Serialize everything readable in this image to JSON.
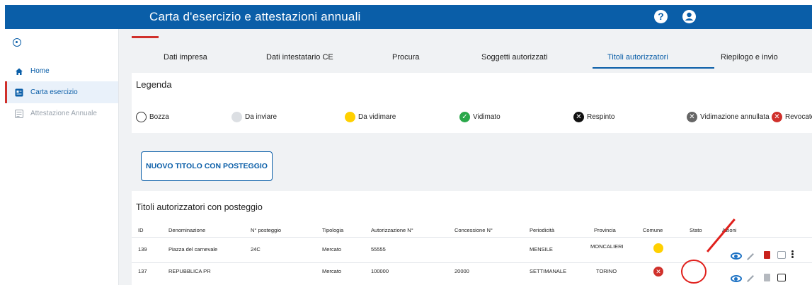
{
  "header": {
    "title": "Carta d'esercizio e attestazioni annuali",
    "help_label": "?",
    "user_label": ""
  },
  "sidebar": {
    "items": [
      {
        "label": "Home"
      },
      {
        "label": "Carta esercizio"
      },
      {
        "label": "Attestazione Annuale"
      }
    ]
  },
  "tabs": [
    {
      "label": "Dati impresa"
    },
    {
      "label": "Dati intestatario CE"
    },
    {
      "label": "Procura"
    },
    {
      "label": "Soggetti autorizzati"
    },
    {
      "label": "Titoli autorizzatori"
    },
    {
      "label": "Riepilogo e invio"
    }
  ],
  "legend": {
    "title": "Legenda",
    "items": [
      {
        "label": "Bozza"
      },
      {
        "label": "Da inviare"
      },
      {
        "label": "Da vidimare"
      },
      {
        "label": "Vidimato"
      },
      {
        "label": "Respinto"
      },
      {
        "label": "Vidimazione annullata"
      },
      {
        "label": "Revocato"
      }
    ]
  },
  "actions": {
    "new_title_button": "NUOVO TITOLO CON POSTEGGIO"
  },
  "table": {
    "title": "Titoli autorizzatori con posteggio",
    "columns": [
      "ID",
      "Denominazione",
      "N° posteggio",
      "Tipologia",
      "Autorizzazione N°",
      "Concessione N°",
      "Periodicità",
      "Provincia",
      "Comune",
      "Stato",
      "Azioni"
    ],
    "rows": [
      {
        "id": "139",
        "denominazione": "Piazza del carnevale",
        "posteggio": "24C",
        "tipologia": "Mercato",
        "autorizzazione": "55555",
        "concessione": "",
        "periodicita": "MENSILE",
        "provincia": "MONCALIERI",
        "comune_status": "Da vidimare",
        "comune_color": "#ffd000",
        "stato": ""
      },
      {
        "id": "137",
        "denominazione": "REPUBBLICA PR",
        "posteggio": "",
        "tipologia": "Mercato",
        "autorizzazione": "100000",
        "concessione": "20000",
        "periodicita": "SETTIMANALE",
        "provincia": "TORINO",
        "comune_status": "Revocato",
        "comune_color": "#d0302b",
        "stato": ""
      }
    ]
  },
  "colors": {
    "primary": "#0a5ea8",
    "accent_red": "#d0302b",
    "highlight": "#e0201c"
  }
}
